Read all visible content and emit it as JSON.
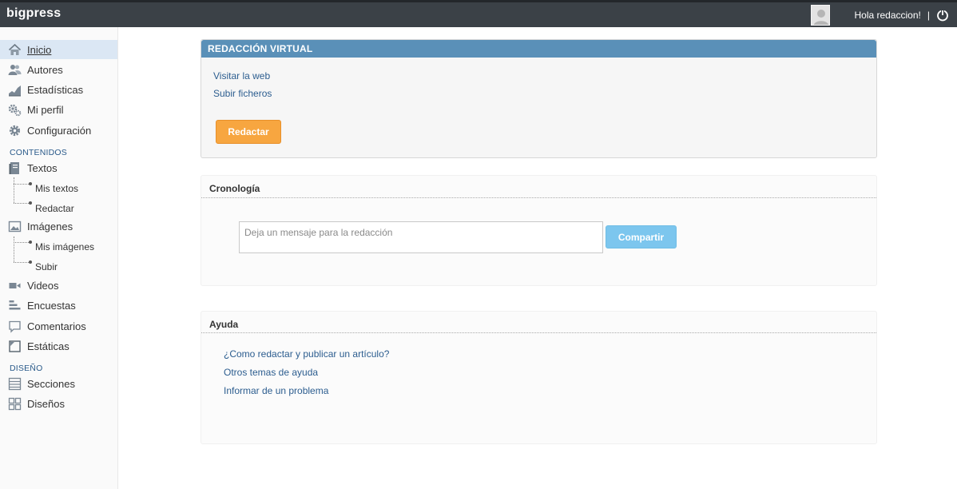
{
  "header": {
    "brand": "bigpress",
    "greeting": "Hola redaccion!",
    "separator": "|",
    "avatar_icon": "user-avatar-icon",
    "logout_icon": "power-icon",
    "colors": {
      "bar": "#3b4147",
      "text": "#ffffff"
    }
  },
  "sidebar": {
    "main_items": [
      {
        "label": "Inicio",
        "icon": "home-icon",
        "active": true
      },
      {
        "label": "Autores",
        "icon": "users-icon"
      },
      {
        "label": "Estadísticas",
        "icon": "stats-chart-icon"
      },
      {
        "label": "Mi perfil",
        "icon": "profile-gears-icon"
      },
      {
        "label": "Configuración",
        "icon": "gear-icon"
      }
    ],
    "contenidos_title": "CONTENIDOS",
    "textos": {
      "label": "Textos",
      "icon": "book-icon",
      "children": [
        "Mis textos",
        "Redactar"
      ]
    },
    "imagenes": {
      "label": "Imágenes",
      "icon": "image-icon",
      "children": [
        "Mis imágenes",
        "Subir"
      ]
    },
    "content_items": [
      {
        "label": "Videos",
        "icon": "video-camera-icon"
      },
      {
        "label": "Encuestas",
        "icon": "poll-bars-icon"
      },
      {
        "label": "Comentarios",
        "icon": "comment-bubble-icon"
      },
      {
        "label": "Estáticas",
        "icon": "static-page-icon"
      }
    ],
    "diseno_title": "DISEÑO",
    "design_items": [
      {
        "label": "Secciones",
        "icon": "sections-list-icon"
      },
      {
        "label": "Diseños",
        "icon": "layout-grid-icon"
      }
    ]
  },
  "redaccion": {
    "title": "REDACCIÓN VIRTUAL",
    "links": [
      "Visitar la web",
      "Subir ficheros"
    ],
    "button_label": "Redactar",
    "colors": {
      "header": "#5a90b8",
      "button": "#f7a640"
    }
  },
  "cronologia": {
    "title": "Cronología",
    "input_placeholder": "Deja un mensaje para la redacción",
    "input_value": "",
    "share_label": "Compartir",
    "colors": {
      "button": "#7cc6ee"
    }
  },
  "ayuda": {
    "title": "Ayuda",
    "links": [
      "¿Como redactar y publicar un artículo?",
      "Otros temas de ayuda",
      "Informar de un problema"
    ]
  }
}
